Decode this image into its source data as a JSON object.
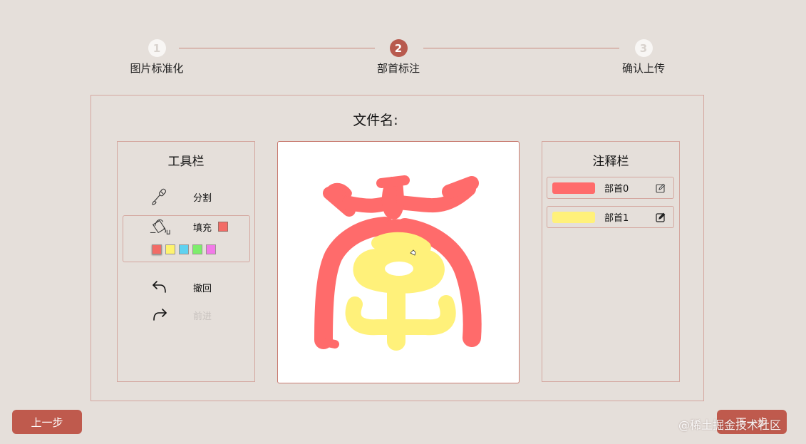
{
  "stepper": {
    "steps": [
      {
        "number": "1",
        "label": "图片标准化"
      },
      {
        "number": "2",
        "label": "部首标注"
      },
      {
        "number": "3",
        "label": "确认上传"
      }
    ]
  },
  "file": {
    "title": "文件名:"
  },
  "toolbar": {
    "title": "工具栏",
    "split_label": "分割",
    "fill_label": "填充",
    "undo_label": "撤回",
    "redo_label": "前进",
    "current_color": "#f26b66",
    "palette": [
      "#f26b66",
      "#fef36e",
      "#5fd2f0",
      "#7ded6c",
      "#f27ae8"
    ]
  },
  "annotations": {
    "title": "注释栏",
    "items": [
      {
        "label": "部首0",
        "color": "#ff6b6b"
      },
      {
        "label": "部首1",
        "color": "#fff17a"
      }
    ]
  },
  "buttons": {
    "prev": "上一步",
    "next": "下一步"
  },
  "watermark": "@稀土掘金技术社区"
}
